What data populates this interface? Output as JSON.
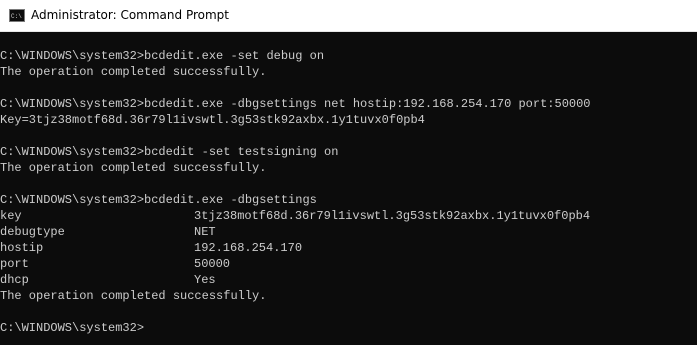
{
  "window": {
    "title": "Administrator: Command Prompt",
    "icon": "cmd-icon"
  },
  "console": {
    "block1": {
      "command": "C:\\WINDOWS\\system32>bcdedit.exe -set debug on",
      "result": "The operation completed successfully."
    },
    "block2": {
      "command": "C:\\WINDOWS\\system32>bcdedit.exe -dbgsettings net hostip:192.168.254.170 port:50000",
      "result": "Key=3tjz38motf68d.36r79l1ivswtl.3g53stk92axbx.1y1tuvx0f0pb4"
    },
    "block3": {
      "command": "C:\\WINDOWS\\system32>bcdedit -set testsigning on",
      "result": "The operation completed successfully."
    },
    "block4": {
      "command": "C:\\WINDOWS\\system32>bcdedit.exe -dbgsettings",
      "settings": [
        {
          "key": "key",
          "value": "3tjz38motf68d.36r79l1ivswtl.3g53stk92axbx.1y1tuvx0f0pb4"
        },
        {
          "key": "debugtype",
          "value": "NET"
        },
        {
          "key": "hostip",
          "value": "192.168.254.170"
        },
        {
          "key": "port",
          "value": "50000"
        },
        {
          "key": "dhcp",
          "value": "Yes"
        }
      ],
      "result": "The operation completed successfully."
    },
    "prompt": "C:\\WINDOWS\\system32>"
  },
  "colors": {
    "console_bg": "#0c0c0c",
    "console_text": "#cccccc",
    "titlebar_bg": "#ffffff"
  }
}
